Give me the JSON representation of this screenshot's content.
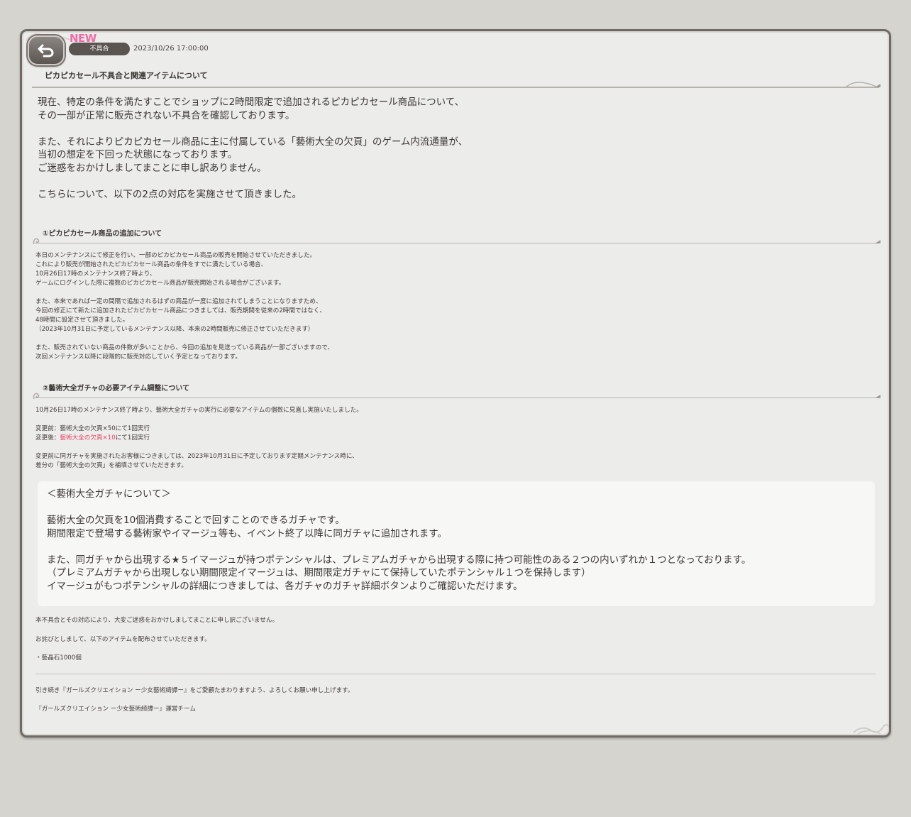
{
  "notice": {
    "new_label": "NEW",
    "category": "不具合",
    "date": "2023/10/26 17:00:00",
    "title": "ピカピカセール不具合と関連アイテムについて"
  },
  "intro": {
    "p1_l1": "現在、特定の条件を満たすことでショップに2時間限定で追加されるピカピカセール商品について、",
    "p1_l2": "その一部が正常に販売されない不具合を確認しております。",
    "p2_l1": "また、それによりピカピカセール商品に主に付属している「藝術大全の欠頁」のゲーム内流通量が、",
    "p2_l2": "当初の想定を下回った状態になっております。",
    "p2_l3": "ご迷惑をおかけしましてまことに申し訳ありません。",
    "p3_l1": "こちらについて、以下の2点の対応を実施させて頂きました。"
  },
  "section1": {
    "heading": "①ピカピカセール商品の追加について",
    "l1": "本日のメンテナンスにて修正を行い、一部のピカピカセール商品の販売を開始させていただきました。",
    "l2": "これにより販売が開始されたピカピカセール商品の条件をすでに満たしている場合、",
    "l3": "10月26日17時のメンテナンス終了時より、",
    "l4": "ゲームにログインした際に複数のピカピカセール商品が販売開始される場合がございます。",
    "l5": "また、本来であれば一定の間隔で追加されるはずの商品が一度に追加されてしまうことになりますため、",
    "l6": "今回の修正にて新たに追加されたピカピカセール商品につきましては、販売期間を従来の2時間ではなく、",
    "l7": "48時間に設定させて頂きました。",
    "l8": "（2023年10月31日に予定しているメンテナンス以降、本来の2時間販売に修正させていただきます）",
    "l9": "また、販売されていない商品の件数が多いことから、今回の追加を見送っている商品が一部ございますので、",
    "l10": "次回メンテナンス以降に段階的に販売対応していく予定となっております。"
  },
  "section2": {
    "heading": "②藝術大全ガチャの必要アイテム調整について",
    "l1": "10月26日17時のメンテナンス終了時より、藝術大全ガチャの実行に必要なアイテムの個数に見直し実施いたしました。",
    "before": "変更前：藝術大全の欠頁×50にて1回実行",
    "after_prefix": "変更後：",
    "after_red": "藝術大全の欠頁×10",
    "after_suffix": "にて1回実行",
    "l2": "変更前に同ガチャを実施されたお客様につきましては、2023年10月31日に予定しております定期メンテナンス時に、",
    "l3": "差分の「藝術大全の欠頁」を補填させていただきます。"
  },
  "infobox": {
    "title": "＜藝術大全ガチャについて＞",
    "l1": "藝術大全の欠頁を10個消費することで回すことのできるガチャです。",
    "l2": "期間限定で登場する藝術家やイマージュ等も、イベント終了以降に同ガチャに追加されます。",
    "l3": "また、同ガチャから出現する★５イマージュが持つポテンシャルは、プレミアムガチャから出現する際に持つ可能性のある２つの内いずれか１つとなっております。",
    "l4": "（プレミアムガチャから出現しない期間限定イマージュは、期間限定ガチャにて保持していたポテンシャル１つを保持します）",
    "l5": "イマージュがもつポテンシャルの詳細につきましては、各ガチャのガチャ詳細ボタンよりご確認いただけます。"
  },
  "closing": {
    "l1": "本不具合とその対応により、大変ご迷惑をおかけしましてまことに申し訳ございません。",
    "l2": "お詫びとしまして、以下のアイテムを配布させていただきます。",
    "l3": "・藝晶石1000個",
    "l4": "引き続き『ガールズクリエイション ー少女藝術綺譚ー』をご愛顧たまわりますよう、よろしくお願い申し上げます。",
    "l5": "『ガールズクリエイション ー少女藝術綺譚ー』運営チーム"
  },
  "icons": {
    "back": "back-arrow-icon"
  }
}
